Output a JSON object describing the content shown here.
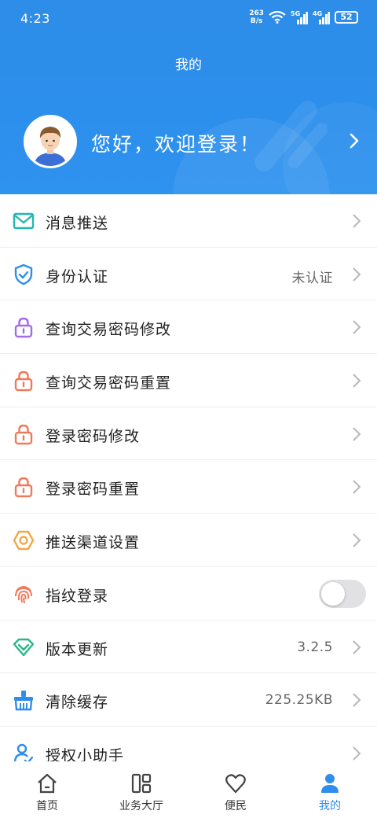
{
  "status_bar": {
    "time": "4:23",
    "net_speed_value": "263",
    "net_speed_unit": "B/s",
    "signal_1": "5G",
    "signal_2": "4G",
    "battery": "52"
  },
  "header": {
    "title": "我的",
    "greeting": "您好，欢迎登录！"
  },
  "menu": [
    {
      "label": "消息推送",
      "value": "",
      "icon": "mail-icon",
      "color": "#21b7b1"
    },
    {
      "label": "身份认证",
      "value": "未认证",
      "icon": "shield-icon",
      "color": "#2e8ee9"
    },
    {
      "label": "查询交易密码修改",
      "value": "",
      "icon": "lock-icon",
      "color": "#a46ce8"
    },
    {
      "label": "查询交易密码重置",
      "value": "",
      "icon": "lock-icon",
      "color": "#ef7a5a"
    },
    {
      "label": "登录密码修改",
      "value": "",
      "icon": "lock-icon",
      "color": "#ef7a5a"
    },
    {
      "label": "登录密码重置",
      "value": "",
      "icon": "lock-icon",
      "color": "#ef7a5a"
    },
    {
      "label": "推送渠道设置",
      "value": "",
      "icon": "hex-nut-icon",
      "color": "#f2a84a"
    },
    {
      "label": "指纹登录",
      "value": "",
      "icon": "fingerprint-icon",
      "color": "#ef7a5a",
      "toggle_on": false
    },
    {
      "label": "版本更新",
      "value": "3.2.5",
      "icon": "diamond-icon",
      "color": "#2cb58c"
    },
    {
      "label": "清除缓存",
      "value": "225.25KB",
      "icon": "basket-icon",
      "color": "#2e8ee9"
    },
    {
      "label": "授权小助手",
      "value": "",
      "icon": "user-check-icon",
      "color": "#2e8ee9"
    }
  ],
  "tabbar": {
    "tabs": [
      {
        "label": "首页",
        "icon": "home-icon",
        "active": false
      },
      {
        "label": "业务大厅",
        "icon": "grid-icon",
        "active": false
      },
      {
        "label": "便民",
        "icon": "heart-icon",
        "active": false
      },
      {
        "label": "我的",
        "icon": "person-icon",
        "active": true
      }
    ],
    "active_color": "#2e8ee9"
  },
  "colors": {
    "header_blue": "#2d8fec",
    "chevron_gray": "#b8b8b8"
  }
}
